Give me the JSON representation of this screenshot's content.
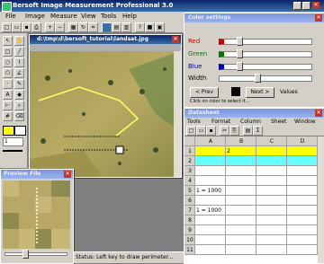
{
  "app": {
    "title": "Bersoft Image Measurement Professional 3.0"
  },
  "menu": [
    "File",
    "Image",
    "Measure",
    "View",
    "Tools",
    "Help"
  ],
  "image_window": {
    "title": "d:\\tmp\\d\\bersoft_tutorial\\landsat.jpg"
  },
  "color_window": {
    "title": "Color settings",
    "red_label": "Red",
    "green_label": "Green",
    "blue_label": "Blue",
    "red_value": "0",
    "green_value": "0",
    "blue_value": "0",
    "color_label": "Color",
    "width_label": "Width",
    "width_value": "1",
    "btn_left": "< Prev",
    "btn_right": "Next >",
    "values_label": "Values",
    "hint": "Click on color to select it..."
  },
  "data_window": {
    "title": "Datasheet",
    "toolbar": [
      "Tools",
      "Format",
      "Column",
      "Sheet",
      "Window"
    ],
    "col_headers": [
      "",
      "A",
      "B",
      "C",
      "D"
    ],
    "rows": [
      [
        "1",
        "",
        "2",
        "",
        ""
      ],
      [
        "2",
        "",
        "",
        "",
        ""
      ],
      [
        "3",
        "",
        "",
        "",
        ""
      ],
      [
        "4",
        "",
        "",
        "",
        ""
      ],
      [
        "5",
        "1 = 1000",
        "",
        "",
        ""
      ],
      [
        "6",
        "",
        "",
        "",
        ""
      ],
      [
        "7",
        "1 = 1000",
        "",
        "",
        ""
      ],
      [
        "8",
        "",
        "",
        "",
        ""
      ],
      [
        "9",
        "",
        "",
        "",
        ""
      ],
      [
        "10",
        "",
        "",
        "",
        ""
      ],
      [
        "11",
        "",
        "",
        "",
        ""
      ]
    ]
  },
  "preview_window": {
    "title": "Preview File"
  },
  "status": {
    "text": "Status: Left key to draw perimeter..."
  },
  "zoom_value": "1",
  "colors": {
    "accent": "#0a246a",
    "highlight": "#ffff00",
    "cyan": "#66ffff"
  }
}
